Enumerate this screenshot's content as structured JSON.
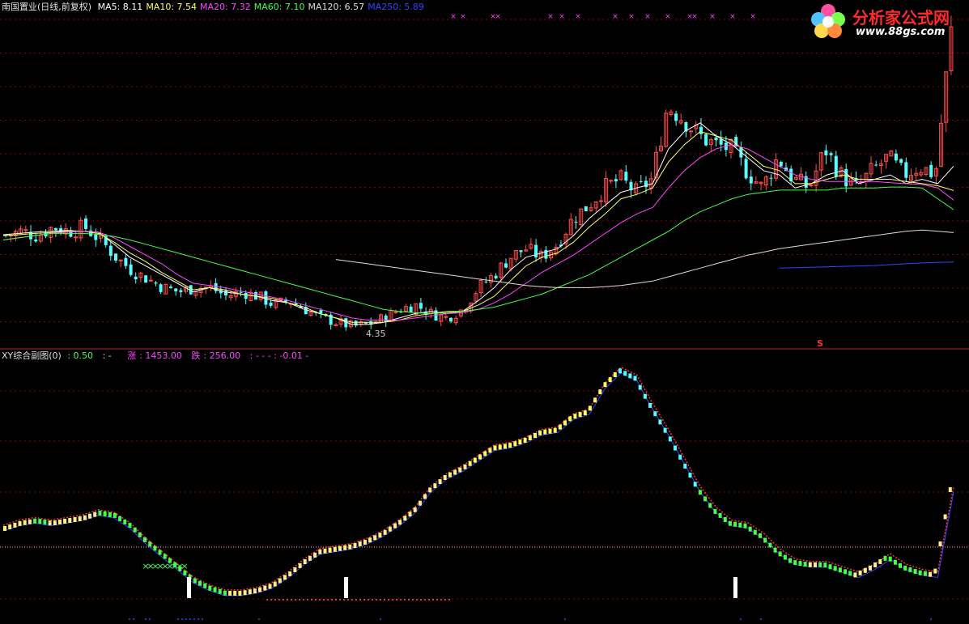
{
  "window": {
    "instrument": "南国置业",
    "period_info": "(日线,前复权)"
  },
  "top_legend": [
    {
      "name": "MA5",
      "value": "8.11",
      "color": "#ffffff"
    },
    {
      "name": "MA10",
      "value": "7.54",
      "color": "#ffff66"
    },
    {
      "name": "MA20",
      "value": "7.32",
      "color": "#ff44ff"
    },
    {
      "name": "MA60",
      "value": "7.10",
      "color": "#44ff44"
    },
    {
      "name": "MA120",
      "value": "6.57",
      "color": "#dddddd"
    },
    {
      "name": "MA250",
      "value": "5.89",
      "color": "#3344ff"
    }
  ],
  "sub_legend": {
    "title": "XY综合副图(0)",
    "v1": ": 0.50",
    "v1_dash": ": -",
    "rise_label": "涨",
    "rise_value": ": 1453.00",
    "fall_label": "跌",
    "fall_value": ": 256.00",
    "tail": ": -  -  -  : -0.01  -"
  },
  "low_label": "4.35",
  "s_mark": "S",
  "logo": {
    "title": "分析家公式网",
    "url": "www.88gs.com"
  },
  "colors": {
    "up": "#ff4d4d",
    "down": "#54ffff",
    "grid": "#8b0000",
    "ma5": "#ffffff",
    "ma10": "#ffff66",
    "ma20": "#ff44ff",
    "ma60": "#44ff44",
    "ma120": "#dddddd",
    "ma250": "#3344ff"
  },
  "chart_data": [
    {
      "type": "candlestick",
      "series": [
        {
          "name": "MA5",
          "values": [
            6.52,
            6.55,
            6.58,
            6.6,
            6.62,
            6.6,
            6.58,
            6.3,
            6.0,
            5.8,
            5.6,
            5.4,
            5.2,
            5.3,
            5.2,
            5.15,
            5.1,
            5.0,
            4.95,
            4.8,
            4.7,
            4.6,
            4.45,
            4.45,
            4.5,
            4.6,
            4.7,
            4.75,
            4.7,
            4.75,
            5.0,
            5.3,
            5.7,
            6.0,
            6.1,
            6.2,
            6.5,
            6.9,
            7.2,
            7.5,
            7.6,
            7.7,
            8.5,
            8.9,
            9.1,
            8.8,
            8.6,
            8.3,
            8.0,
            7.9,
            7.6,
            7.7,
            7.9,
            8.0,
            7.7,
            7.8,
            7.9,
            7.7,
            7.8,
            7.7,
            8.1
          ]
        },
        {
          "name": "MA10",
          "values": [
            6.5,
            6.52,
            6.55,
            6.57,
            6.6,
            6.6,
            6.55,
            6.35,
            6.1,
            5.9,
            5.65,
            5.45,
            5.25,
            5.3,
            5.25,
            5.15,
            5.1,
            5.05,
            4.95,
            4.85,
            4.7,
            4.6,
            4.5,
            4.5,
            4.5,
            4.55,
            4.65,
            4.7,
            4.75,
            4.75,
            4.9,
            5.1,
            5.45,
            5.8,
            6.0,
            6.1,
            6.35,
            6.7,
            7.0,
            7.35,
            7.45,
            7.6,
            8.2,
            8.6,
            8.9,
            8.8,
            8.7,
            8.4,
            8.1,
            8.0,
            7.7,
            7.7,
            7.8,
            7.9,
            7.8,
            7.8,
            7.8,
            7.75,
            7.7,
            7.65,
            7.54
          ]
        },
        {
          "name": "MA20",
          "values": [
            6.4,
            6.45,
            6.5,
            6.55,
            6.58,
            6.6,
            6.58,
            6.45,
            6.25,
            6.05,
            5.85,
            5.6,
            5.4,
            5.35,
            5.3,
            5.22,
            5.15,
            5.08,
            5.0,
            4.9,
            4.8,
            4.7,
            4.6,
            4.55,
            4.55,
            4.55,
            4.6,
            4.65,
            4.7,
            4.72,
            4.8,
            4.95,
            5.15,
            5.4,
            5.65,
            5.85,
            6.05,
            6.3,
            6.55,
            6.8,
            7.0,
            7.15,
            7.6,
            8.0,
            8.3,
            8.5,
            8.6,
            8.5,
            8.3,
            8.1,
            7.9,
            7.8,
            7.75,
            7.75,
            7.75,
            7.75,
            7.72,
            7.7,
            7.68,
            7.6,
            7.32
          ]
        },
        {
          "name": "MA60",
          "values": [
            6.4,
            6.45,
            6.5,
            6.55,
            6.55,
            6.55,
            6.53,
            6.48,
            6.4,
            6.3,
            6.2,
            6.1,
            6.0,
            5.9,
            5.8,
            5.7,
            5.6,
            5.5,
            5.4,
            5.3,
            5.2,
            5.1,
            5.0,
            4.9,
            4.8,
            4.75,
            4.72,
            4.7,
            4.72,
            4.75,
            4.8,
            4.85,
            4.95,
            5.05,
            5.15,
            5.3,
            5.45,
            5.6,
            5.8,
            6.0,
            6.2,
            6.4,
            6.6,
            6.85,
            7.05,
            7.2,
            7.35,
            7.45,
            7.5,
            7.55,
            7.55,
            7.55,
            7.55,
            7.6,
            7.6,
            7.6,
            7.62,
            7.62,
            7.6,
            7.35,
            7.1
          ]
        },
        {
          "name": "MA120",
          "values": [
            null,
            null,
            null,
            null,
            null,
            null,
            null,
            null,
            null,
            null,
            null,
            null,
            null,
            null,
            null,
            null,
            null,
            null,
            null,
            null,
            null,
            5.95,
            5.9,
            5.85,
            5.8,
            5.75,
            5.7,
            5.65,
            5.6,
            5.55,
            5.5,
            5.45,
            5.4,
            5.35,
            5.32,
            5.3,
            5.3,
            5.3,
            5.32,
            5.35,
            5.4,
            5.45,
            5.55,
            5.65,
            5.75,
            5.85,
            5.95,
            6.05,
            6.12,
            6.2,
            6.25,
            6.3,
            6.35,
            6.4,
            6.45,
            6.5,
            6.55,
            6.6,
            6.63,
            6.6,
            6.57
          ]
        },
        {
          "name": "MA250",
          "values": [
            null,
            null,
            null,
            null,
            null,
            null,
            null,
            null,
            null,
            null,
            null,
            null,
            null,
            null,
            null,
            null,
            null,
            null,
            null,
            null,
            null,
            null,
            null,
            null,
            null,
            null,
            null,
            null,
            null,
            null,
            null,
            null,
            null,
            null,
            null,
            null,
            null,
            null,
            null,
            null,
            null,
            null,
            null,
            null,
            null,
            null,
            null,
            null,
            null,
            5.75,
            5.76,
            5.77,
            5.78,
            5.79,
            5.8,
            5.81,
            5.83,
            5.85,
            5.87,
            5.88,
            5.89
          ]
        }
      ],
      "price": {
        "closes": [
          6.5,
          6.6,
          6.5,
          6.7,
          6.6,
          6.7,
          6.4,
          6.0,
          5.7,
          5.5,
          5.3,
          5.2,
          5.3,
          5.3,
          5.1,
          5.2,
          5.1,
          4.9,
          5.0,
          4.8,
          4.6,
          4.5,
          4.4,
          4.45,
          4.6,
          4.8,
          4.9,
          4.7,
          4.6,
          4.8,
          5.3,
          5.6,
          6.0,
          6.2,
          6.0,
          6.3,
          6.9,
          7.2,
          7.6,
          7.8,
          7.5,
          7.8,
          9.5,
          9.2,
          8.8,
          8.6,
          8.5,
          8.0,
          7.6,
          8.3,
          7.8,
          7.6,
          8.5,
          7.9,
          7.6,
          8.0,
          8.3,
          7.9,
          8.1,
          7.9,
          11.2
        ],
        "min": 4.35,
        "max": 11.2
      }
    },
    {
      "type": "line",
      "legend": {
        "rise": 1453.0,
        "fall": 256.0,
        "value": 0.5,
        "last": -0.01
      },
      "values": [
        0.35,
        0.37,
        0.38,
        0.37,
        0.38,
        0.39,
        0.41,
        0.4,
        0.36,
        0.3,
        0.25,
        0.2,
        0.15,
        0.12,
        0.1,
        0.1,
        0.11,
        0.13,
        0.17,
        0.22,
        0.26,
        0.27,
        0.28,
        0.3,
        0.33,
        0.37,
        0.42,
        0.5,
        0.55,
        0.58,
        0.62,
        0.66,
        0.67,
        0.69,
        0.72,
        0.73,
        0.78,
        0.8,
        0.9,
        0.96,
        0.93,
        0.82,
        0.72,
        0.61,
        0.5,
        0.42,
        0.37,
        0.36,
        0.32,
        0.26,
        0.22,
        0.21,
        0.21,
        0.19,
        0.17,
        0.2,
        0.24,
        0.2,
        0.18,
        0.17,
        0.5
      ],
      "ylim": [
        0,
        1
      ]
    }
  ]
}
